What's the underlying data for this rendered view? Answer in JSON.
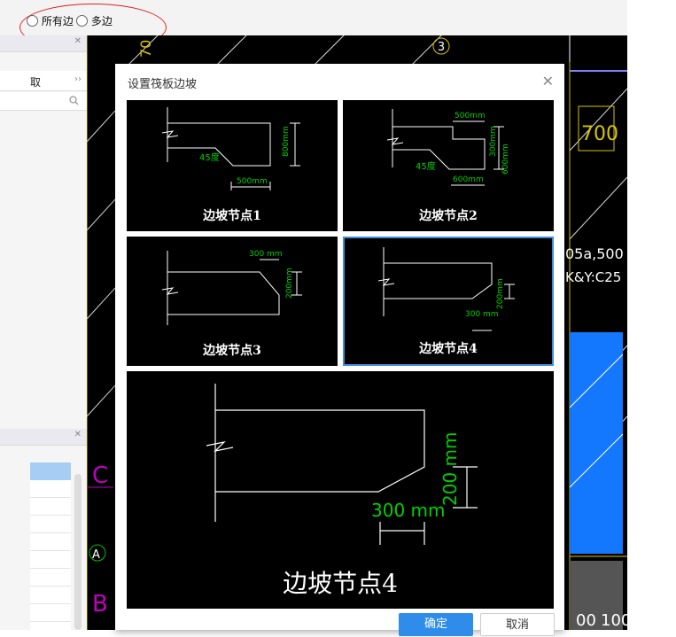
{
  "topbar": {
    "radio_all_edges": "所有边",
    "radio_multi_edges": "多边"
  },
  "dialog": {
    "title": "设置筏板边坡",
    "close_glyph": "✕",
    "thumbnails": [
      {
        "caption": "边坡节点1",
        "dims": [
          "45度",
          "500mm",
          "800mm"
        ]
      },
      {
        "caption": "边坡节点2",
        "dims": [
          "500mm",
          "300mm",
          "600mm",
          "45度",
          "600mm"
        ]
      },
      {
        "caption": "边坡节点3",
        "dims": [
          "300 mm",
          "200mm"
        ]
      },
      {
        "caption": "边坡节点4",
        "dims": [
          "300 mm",
          "200mm"
        ],
        "selected": true
      }
    ],
    "preview": {
      "caption": "边坡节点4",
      "dim_h": "300 mm",
      "dim_v": "200 mm"
    },
    "ok_label": "确定",
    "cancel_label": "取消"
  },
  "left_panel": {
    "item_label": "取",
    "more_glyph": "››",
    "close_glyph": "✕"
  },
  "cad": {
    "axis_labels": [
      "3",
      "A"
    ],
    "texts": [
      "700",
      "05a,500",
      "K&Y:C25",
      "00",
      "100",
      "70"
    ]
  },
  "colors": {
    "accent": "#2f8ceb",
    "cad_green": "#00c000",
    "cad_yellow": "#d8c400",
    "cad_magenta": "#c000c0",
    "cad_blue": "#1478ff",
    "highlight": "#dd2222"
  }
}
